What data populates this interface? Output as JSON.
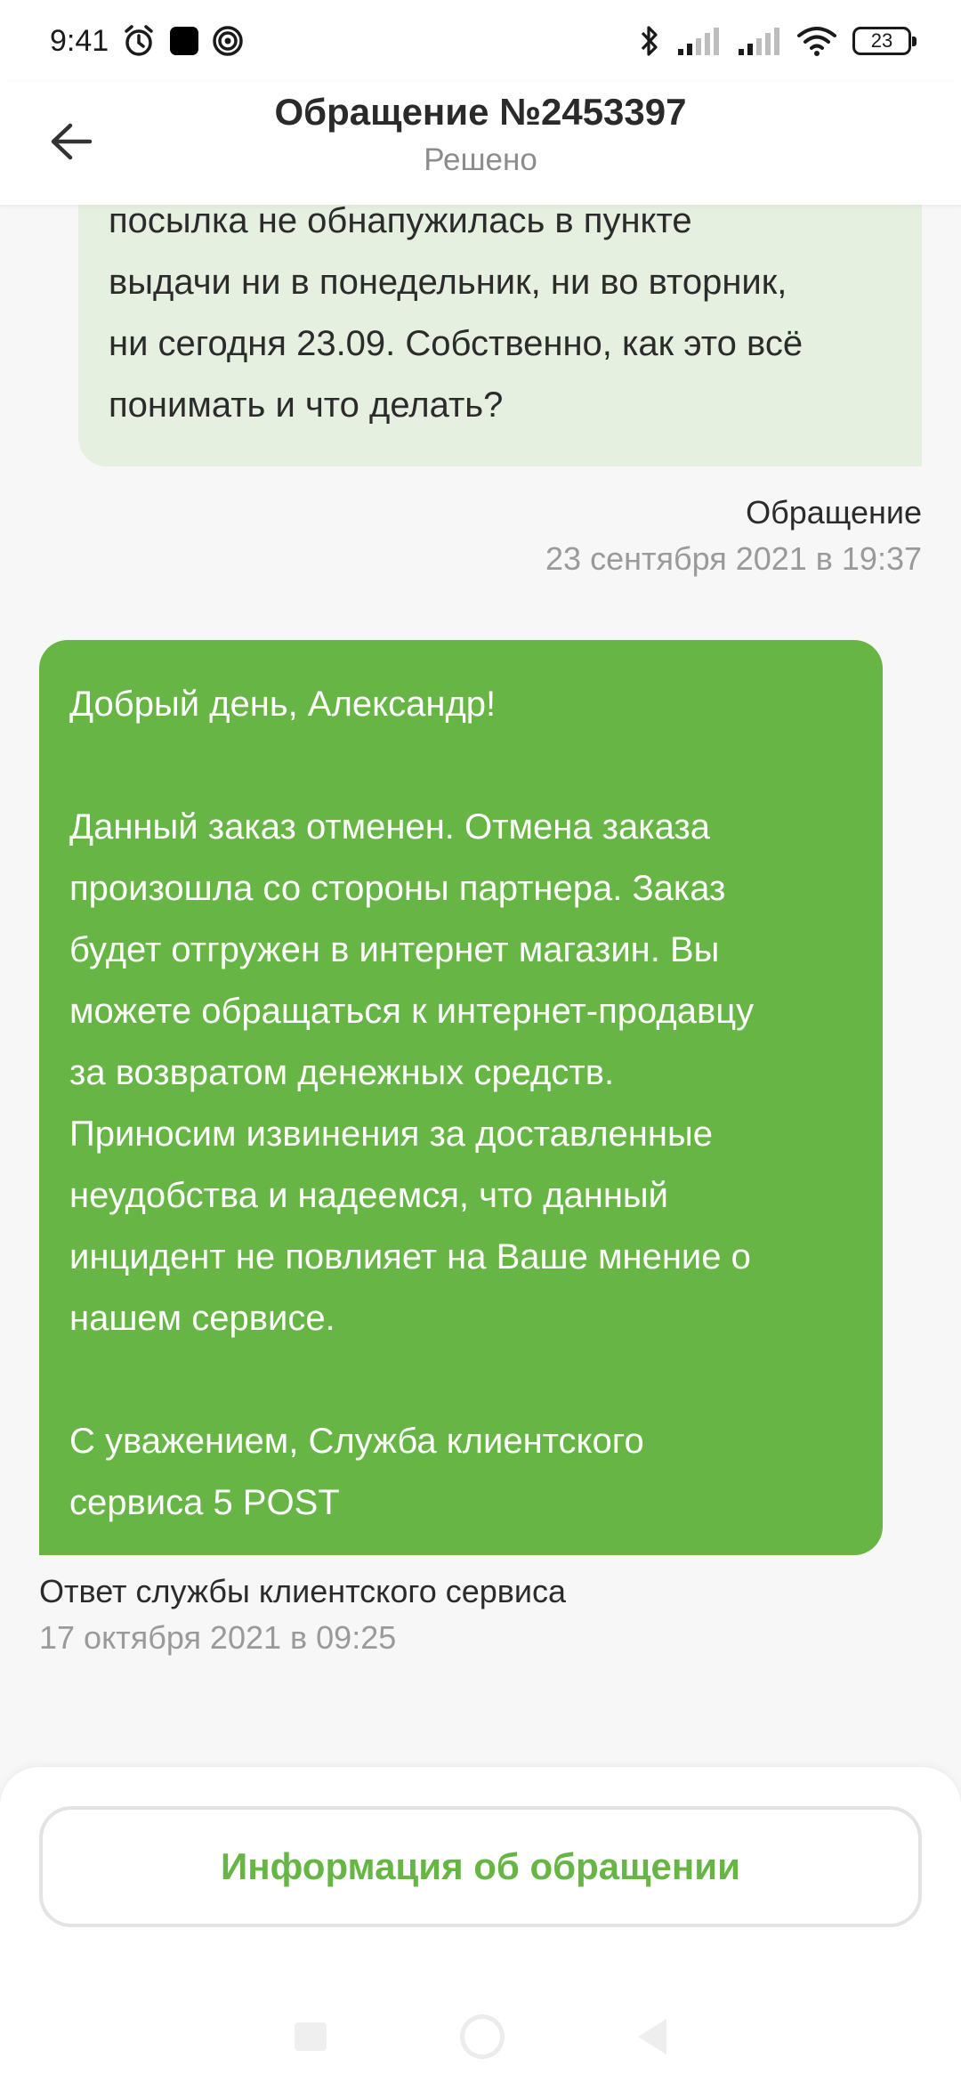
{
  "status_bar": {
    "time": "9:41",
    "battery": "23",
    "left_icons": [
      "alarm-icon",
      "app-square-icon",
      "target-icon"
    ],
    "right_icons": [
      "bluetooth-icon",
      "signal-icon",
      "signal-icon",
      "wifi-icon",
      "battery-icon"
    ]
  },
  "header": {
    "title": "Обращение №2453397",
    "subtitle": "Решено",
    "back_icon": "arrow-left-icon"
  },
  "messages": {
    "user": {
      "lines": [
        "посылка не обнапужилась в пункте",
        "выдачи ни в понедельник, ни во вторник,",
        "ни сегодня 23.09. Собственно, как это всё",
        "понимать и что делать?"
      ],
      "author": "Обращение",
      "date": "23 сентября 2021 в 19:37"
    },
    "support": {
      "lines": [
        "Добрый день, Александр!",
        "",
        "Данный заказ отменен. Отмена заказа",
        "произошла со стороны партнера. Заказ",
        "будет отгружен в интернет магазин. Вы",
        "можете обращаться к интернет-продавцу",
        "за возвратом денежных средств.",
        "Приносим извинения за доставленные",
        "неудобства и надеемся, что данный",
        "инцидент не повлияет на Ваше мнение о",
        "нашем сервисе.",
        "",
        "С уважением, Служба клиентского",
        "сервиса 5 POST"
      ],
      "author": "Ответ службы клиентского сервиса",
      "date": "17 октября 2021 в 09:25"
    }
  },
  "bottom": {
    "info_button_label": "Информация об обращении"
  },
  "colors": {
    "accent_green": "#67b544",
    "user_bubble": "#e5f0e0",
    "muted_text": "#9a9a9a"
  }
}
